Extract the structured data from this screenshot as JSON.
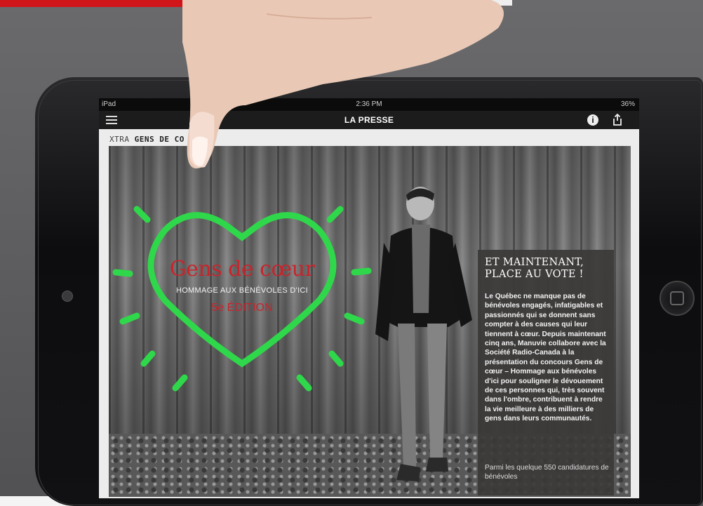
{
  "device": {
    "status_left": "iPad",
    "time": "2:36 PM",
    "status_right": "36%"
  },
  "navbar": {
    "title": "LA PRESSE",
    "info_icon": "info-icon",
    "share_icon": "share-icon",
    "menu_icon": "menu-icon"
  },
  "section": {
    "prefix": "XTRA",
    "name": "GENS DE CO"
  },
  "graphic": {
    "title": "Gens de cœur",
    "subtitle": "HOMMAGE AUX BÉNÉVOLES D'ICI",
    "edition": "5e ÉDITION"
  },
  "article": {
    "heading": "ET MAINTENANT, PLACE AU VOTE !",
    "body": "Le Québec ne manque pas de bénévoles engagés, infatigables et passionnés qui se donnent sans compter à des causes qui leur tiennent à cœur. Depuis maintenant cinq ans, Manuvie collabore avec la Société Radio-Canada à la présentation du concours Gens de cœur – Hommage aux bénévoles d'ici pour souligner le dévouement de ces personnes qui, très souvent dans l'ombre, contribuent à rendre la vie meilleure à des milliers de gens dans leurs communautés.",
    "body_2": "Parmi les quelque 550 candidatures de bénévoles"
  },
  "colors": {
    "accent_red": "#d0151b",
    "neon_green": "#2fd84a",
    "title_red": "#c9242b"
  }
}
